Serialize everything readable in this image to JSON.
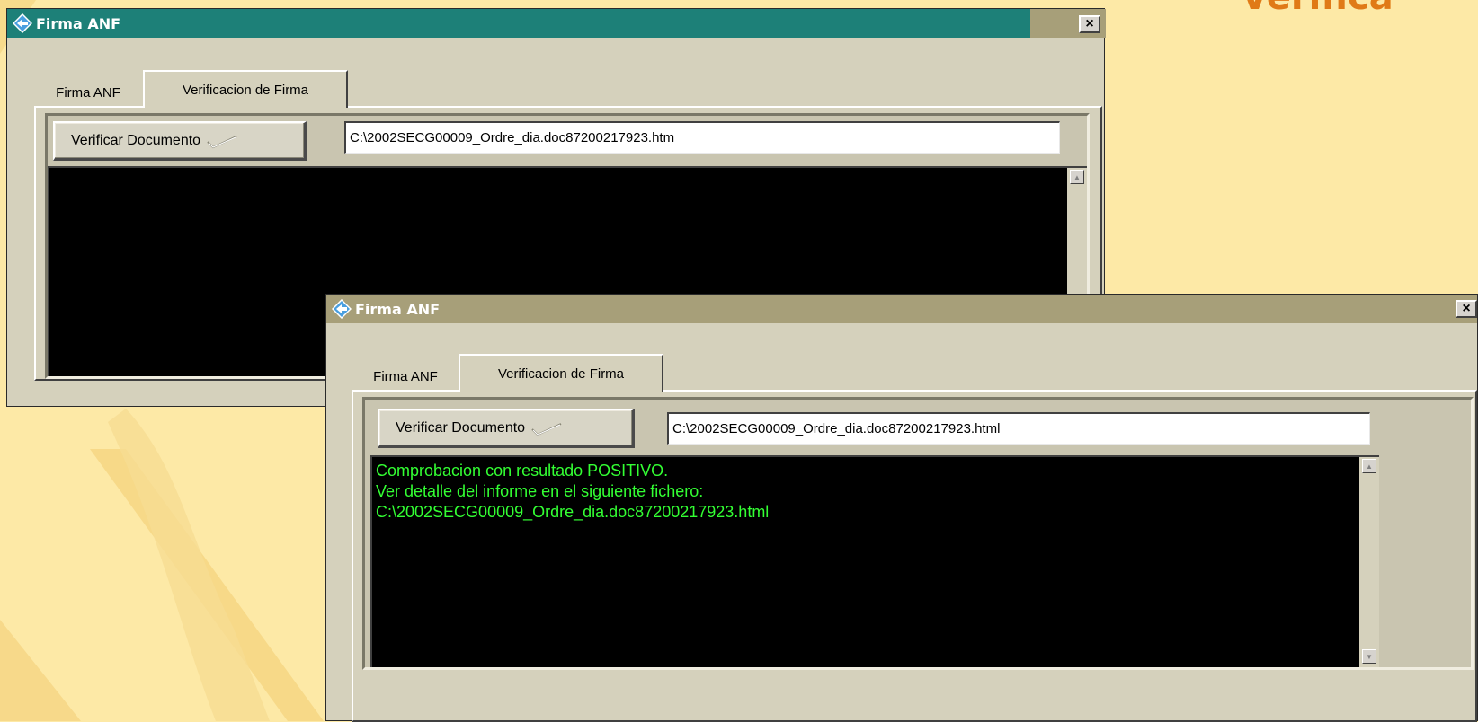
{
  "slide": {
    "title": "Verifica"
  },
  "window_back": {
    "title": "Firma ANF",
    "close_label": "×",
    "tabs": [
      {
        "label": "Firma ANF",
        "active": false
      },
      {
        "label": "Verificacion de Firma",
        "active": true
      }
    ],
    "verify_button_label": "Verificar  Documento",
    "path_value": "C:\\2002SECG00009_Ordre_dia.doc87200217923.htm",
    "console_lines": []
  },
  "window_front": {
    "title": "Firma ANF",
    "close_label": "×",
    "tabs": [
      {
        "label": "Firma ANF",
        "active": false
      },
      {
        "label": "Verificacion de Firma",
        "active": true
      }
    ],
    "verify_button_label": "Verificar  Documento",
    "path_value": "C:\\2002SECG00009_Ordre_dia.doc87200217923.html",
    "console_lines": [
      "Comprobacion con resultado POSITIVO.",
      "Ver detalle del informe en el siguiente fichero:",
      "C:\\2002SECG00009_Ordre_dia.doc87200217923.html"
    ]
  },
  "colors": {
    "background": "#fde9a6",
    "back_titlebar": "#1d8078",
    "front_titlebar": "#a79f79",
    "console_text": "#33ff33",
    "slide_title": "#e07a17"
  },
  "icons": {
    "app": "diamond-arrows-icon",
    "check": "checkmark-icon",
    "close": "close-x-icon",
    "scroll_up": "scroll-up-arrow-icon",
    "scroll_down": "scroll-down-arrow-icon"
  }
}
